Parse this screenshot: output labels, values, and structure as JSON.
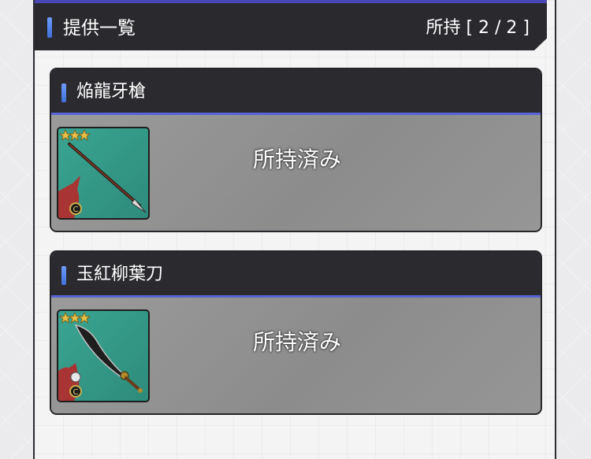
{
  "header": {
    "title": "提供一覧",
    "count_label": "所持 [ 2 / 2 ]"
  },
  "items": [
    {
      "name": "焔龍牙槍",
      "status": "所持済み",
      "rarity_stars": 3,
      "icon": "spear-icon"
    },
    {
      "name": "玉紅柳葉刀",
      "status": "所持済み",
      "rarity_stars": 3,
      "icon": "saber-icon"
    }
  ],
  "colors": {
    "header_bg": "#2a2a2e",
    "accent_blue": "#5a7fe8",
    "header_top_line": "#4a48b8",
    "icon_bg": "#3aa592",
    "star_gold": "#e8c04a"
  }
}
